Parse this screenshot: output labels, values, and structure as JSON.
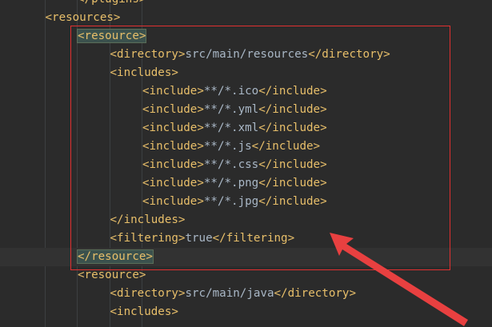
{
  "editor": {
    "lines": [
      {
        "indent": 2,
        "parts": [
          {
            "t": "</plugins>",
            "k": "tag"
          }
        ]
      },
      {
        "indent": 1,
        "parts": [
          {
            "t": "<resources>",
            "k": "tag"
          }
        ]
      },
      {
        "indent": 2,
        "parts": [
          {
            "t": "<resource>",
            "k": "tag",
            "hl": true
          }
        ]
      },
      {
        "indent": 3,
        "parts": [
          {
            "t": "<directory>",
            "k": "tag"
          },
          {
            "t": "src/main/resources",
            "k": "txt"
          },
          {
            "t": "</directory>",
            "k": "tag"
          }
        ]
      },
      {
        "indent": 3,
        "parts": [
          {
            "t": "<includes>",
            "k": "tag"
          }
        ]
      },
      {
        "indent": 4,
        "parts": [
          {
            "t": "<include>",
            "k": "tag"
          },
          {
            "t": "**/*.ico",
            "k": "txt"
          },
          {
            "t": "</include>",
            "k": "tag"
          }
        ]
      },
      {
        "indent": 4,
        "parts": [
          {
            "t": "<include>",
            "k": "tag"
          },
          {
            "t": "**/*.yml",
            "k": "txt"
          },
          {
            "t": "</include>",
            "k": "tag"
          }
        ]
      },
      {
        "indent": 4,
        "parts": [
          {
            "t": "<include>",
            "k": "tag"
          },
          {
            "t": "**/*.xml",
            "k": "txt"
          },
          {
            "t": "</include>",
            "k": "tag"
          }
        ]
      },
      {
        "indent": 4,
        "parts": [
          {
            "t": "<include>",
            "k": "tag"
          },
          {
            "t": "**/*.js",
            "k": "txt"
          },
          {
            "t": "</include>",
            "k": "tag"
          }
        ]
      },
      {
        "indent": 4,
        "parts": [
          {
            "t": "<include>",
            "k": "tag"
          },
          {
            "t": "**/*.css",
            "k": "txt"
          },
          {
            "t": "</include>",
            "k": "tag"
          }
        ]
      },
      {
        "indent": 4,
        "parts": [
          {
            "t": "<include>",
            "k": "tag"
          },
          {
            "t": "**/*.png",
            "k": "txt"
          },
          {
            "t": "</include>",
            "k": "tag"
          }
        ]
      },
      {
        "indent": 4,
        "parts": [
          {
            "t": "<include>",
            "k": "tag"
          },
          {
            "t": "**/*.jpg",
            "k": "txt"
          },
          {
            "t": "</include>",
            "k": "tag"
          }
        ]
      },
      {
        "indent": 3,
        "parts": [
          {
            "t": "</includes>",
            "k": "tag"
          }
        ]
      },
      {
        "indent": 3,
        "parts": [
          {
            "t": "<filtering>",
            "k": "tag"
          },
          {
            "t": "true",
            "k": "txt"
          },
          {
            "t": "</filtering>",
            "k": "tag"
          }
        ]
      },
      {
        "indent": 2,
        "current": true,
        "parts": [
          {
            "t": "</resource>",
            "k": "tag",
            "hl": true
          }
        ]
      },
      {
        "indent": 2,
        "parts": [
          {
            "t": "<resource>",
            "k": "tag"
          }
        ]
      },
      {
        "indent": 3,
        "parts": [
          {
            "t": "<directory>",
            "k": "tag"
          },
          {
            "t": "src/main/java",
            "k": "txt"
          },
          {
            "t": "</directory>",
            "k": "tag"
          }
        ]
      },
      {
        "indent": 3,
        "parts": [
          {
            "t": "<includes>",
            "k": "tag"
          }
        ]
      }
    ]
  },
  "colors": {
    "background": "#2b2b2b",
    "tag": "#e8bf6a",
    "text": "#a9b7c6",
    "annotation": "#e03030"
  }
}
